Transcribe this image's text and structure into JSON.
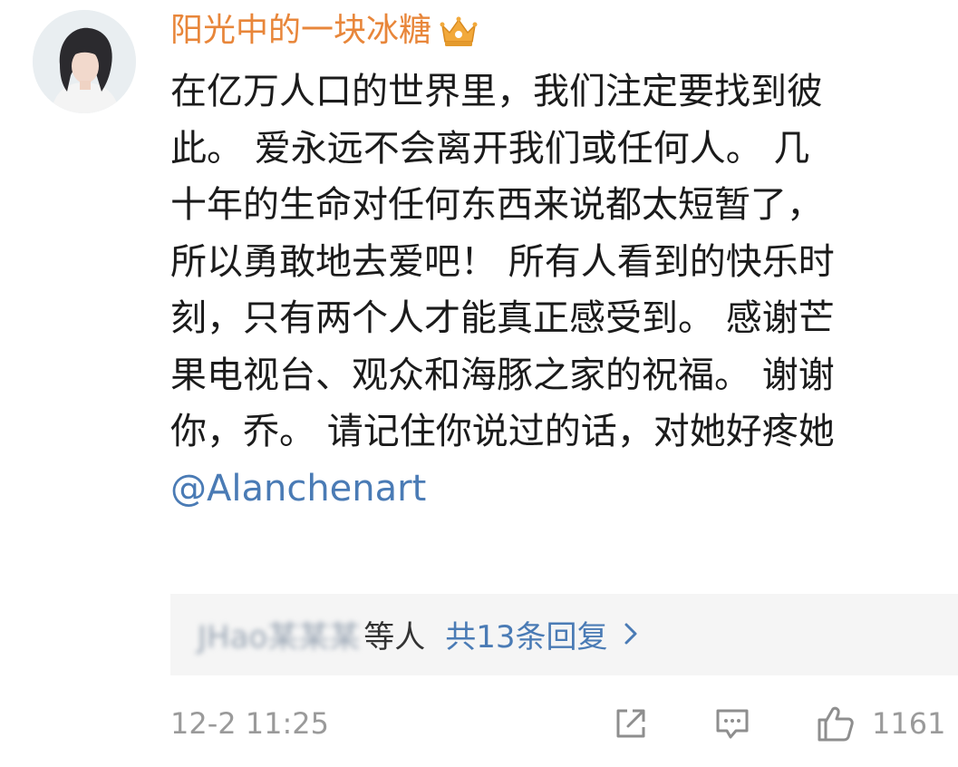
{
  "comment": {
    "username": "阳光中的一块冰糖",
    "badge_icon": "crown-icon",
    "lines": [
      "在亿万人口的世界里，我们注定要找到彼",
      "此。 爱永远不会离开我们或任何人。 几",
      "十年的生命对任何东西来说都太短暂了，",
      "所以勇敢地去爱吧！ 所有人看到的快乐时",
      "刻，只有两个人才能真正感受到。 感谢芒",
      "果电视台、观众和海豚之家的祝福。 谢谢",
      "你，乔。 请记住你说过的话，对她好疼她"
    ],
    "mention": "@Alanchenart",
    "colors": {
      "username": "#e8863a",
      "link": "#4a7bb5",
      "meta": "#9a9a9a",
      "reply_bg": "#f5f5f5"
    }
  },
  "replies": {
    "names_blurred": "JHao某某某",
    "suffix": "等人",
    "link_label": "共13条回复"
  },
  "footer": {
    "timestamp": "12-2 11:25",
    "share_icon": "share-icon",
    "comment_icon": "comment-icon",
    "like_icon": "thumbs-up-icon",
    "like_count": "1161"
  }
}
